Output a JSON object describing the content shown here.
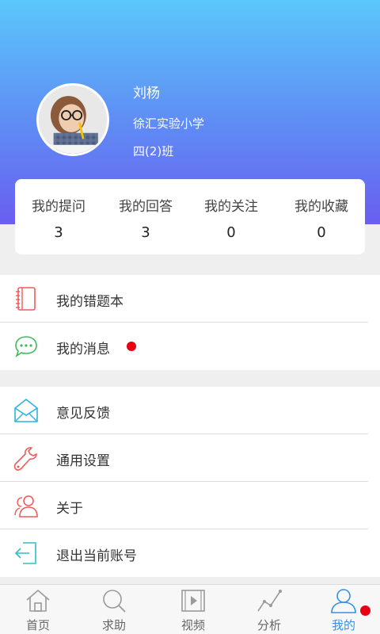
{
  "profile": {
    "name": "刘杨",
    "school": "徐汇实验小学",
    "class_name": "四(2)班"
  },
  "stats": [
    {
      "label": "我的提问",
      "value": "3"
    },
    {
      "label": "我的回答",
      "value": "3"
    },
    {
      "label": "我的关注",
      "value": "0"
    },
    {
      "label": "我的收藏",
      "value": "0"
    }
  ],
  "menu": {
    "group1": [
      {
        "label": "我的错题本",
        "icon": "notebook-icon",
        "unread": false
      },
      {
        "label": "我的消息",
        "icon": "chat-bubble-icon",
        "unread": true
      }
    ],
    "group2": [
      {
        "label": "意见反馈",
        "icon": "envelope-icon"
      },
      {
        "label": "通用设置",
        "icon": "wrench-icon"
      },
      {
        "label": "关于",
        "icon": "users-icon"
      },
      {
        "label": "退出当前账号",
        "icon": "logout-icon"
      }
    ]
  },
  "tabbar": {
    "items": [
      {
        "label": "首页",
        "icon": "home-icon",
        "active": false
      },
      {
        "label": "求助",
        "icon": "search-icon",
        "active": false
      },
      {
        "label": "视频",
        "icon": "video-play-icon",
        "active": false
      },
      {
        "label": "分析",
        "icon": "line-chart-icon",
        "active": false
      },
      {
        "label": "我的",
        "icon": "user-icon",
        "active": true,
        "badge": true
      }
    ]
  },
  "colors": {
    "header_gradient_top": "#5bc7fb",
    "header_gradient_bottom": "#6a5ef0",
    "accent": "#3a8ee6",
    "unread_dot": "#e60012"
  }
}
